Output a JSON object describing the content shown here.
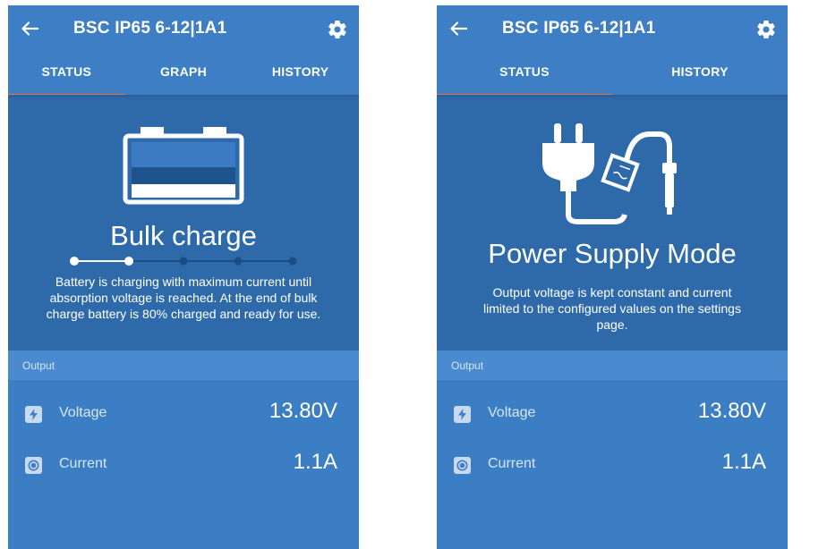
{
  "left_screen": {
    "title": "BSC IP65 6-12|1A1",
    "tabs": [
      {
        "label": "STATUS",
        "active": true
      },
      {
        "label": "GRAPH",
        "active": false
      },
      {
        "label": "HISTORY",
        "active": false
      }
    ],
    "state_title": "Bulk charge",
    "state_description": "Battery is charging with maximum current until absorption voltage is reached. At the end of bulk charge battery is 80% charged and ready for use.",
    "charge_steps_total": 5,
    "charge_step_current": 2,
    "section_label": "Output",
    "rows": [
      {
        "icon": "lightning-icon",
        "label": "Voltage",
        "value": "13.80V"
      },
      {
        "icon": "current-icon",
        "label": "Current",
        "value": "1.1A"
      }
    ]
  },
  "right_screen": {
    "title": "BSC IP65 6-12|1A1",
    "tabs": [
      {
        "label": "STATUS",
        "active": true
      },
      {
        "label": "HISTORY",
        "active": false
      }
    ],
    "state_title": "Power Supply Mode",
    "state_description": "Output voltage is kept constant and current limited to the configured values on the settings page.",
    "section_label": "Output",
    "rows": [
      {
        "icon": "lightning-icon",
        "label": "Voltage",
        "value": "13.80V"
      },
      {
        "icon": "current-icon",
        "label": "Current",
        "value": "1.1A"
      }
    ]
  },
  "colors": {
    "header_blue": "#3d7ec4",
    "hero_blue": "#2e6aaa",
    "section_blue": "#4a8bd0",
    "tab_indicator": "#e07a3e"
  }
}
